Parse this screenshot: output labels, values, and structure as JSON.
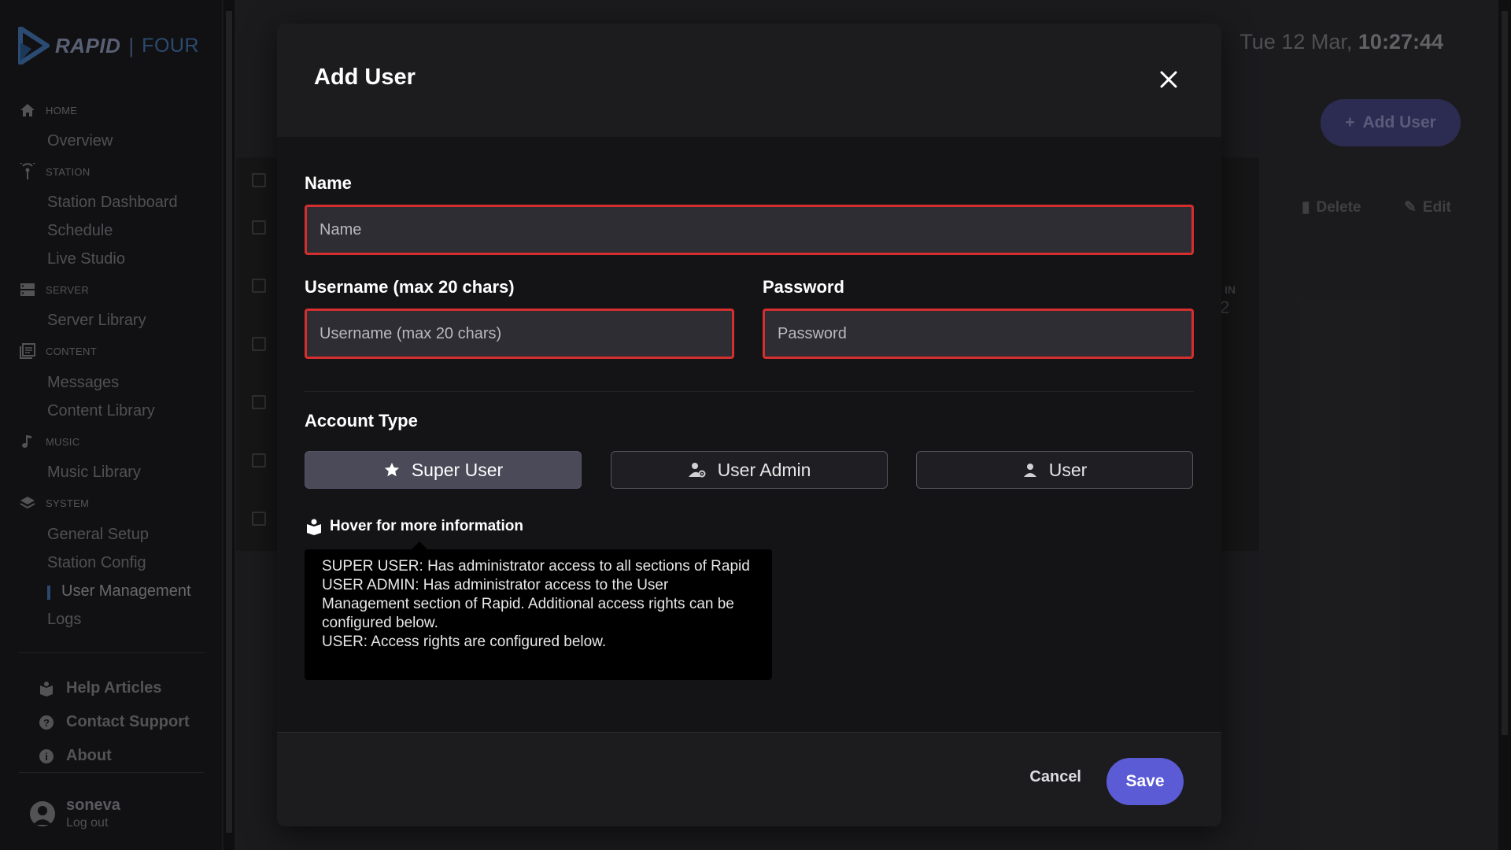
{
  "app": {
    "brand": "RAPID",
    "brand_suffix": "FOUR"
  },
  "clock": {
    "date": "Tue 12 Mar,",
    "time": "10:27:44"
  },
  "sidebar": {
    "sections": [
      {
        "label": "HOME",
        "icon": "home-icon",
        "items": [
          "Overview"
        ]
      },
      {
        "label": "STATION",
        "icon": "antenna-icon",
        "items": [
          "Station Dashboard",
          "Schedule",
          "Live Studio"
        ]
      },
      {
        "label": "SERVER",
        "icon": "server-icon",
        "items": [
          "Server Library"
        ]
      },
      {
        "label": "CONTENT",
        "icon": "content-icon",
        "items": [
          "Messages",
          "Content Library"
        ]
      },
      {
        "label": "MUSIC",
        "icon": "music-note-icon",
        "items": [
          "Music Library"
        ]
      },
      {
        "label": "SYSTEM",
        "icon": "layers-icon",
        "items": [
          "General Setup",
          "Station Config",
          "User Management",
          "Logs"
        ]
      }
    ],
    "active_item": "User Management",
    "help": {
      "help_articles": "Help Articles",
      "contact_support": "Contact Support",
      "about": "About"
    },
    "user": {
      "name": "soneva",
      "logout": "Log out"
    }
  },
  "background": {
    "add_user_label": "Add User",
    "delete_label": "Delete",
    "edit_label": "Edit",
    "column_fragment": "IN",
    "value_fragment": "2"
  },
  "modal": {
    "title": "Add User",
    "name_label": "Name",
    "name_placeholder": "Name",
    "username_label": "Username (max 20 chars)",
    "username_placeholder": "Username (max 20 chars)",
    "password_label": "Password",
    "password_placeholder": "Password",
    "account_type_label": "Account Type",
    "account_types": [
      {
        "label": "Super User",
        "icon": "star-icon",
        "selected": true
      },
      {
        "label": "User Admin",
        "icon": "user-gear-icon",
        "selected": false
      },
      {
        "label": "User",
        "icon": "person-icon",
        "selected": false
      }
    ],
    "hover_label": "Hover for more information",
    "tooltip": {
      "line1": "SUPER USER: Has administrator access to all sections of Rapid",
      "line2": "USER ADMIN: Has administrator access to the User Management section of Rapid. Additional access rights can be configured below.",
      "line3": "USER: Access rights are configured below."
    },
    "cancel_label": "Cancel",
    "save_label": "Save"
  },
  "colors": {
    "accent": "#5b5bd6",
    "error_border": "#d32f2f",
    "brand_blue": "#4a82c4"
  }
}
